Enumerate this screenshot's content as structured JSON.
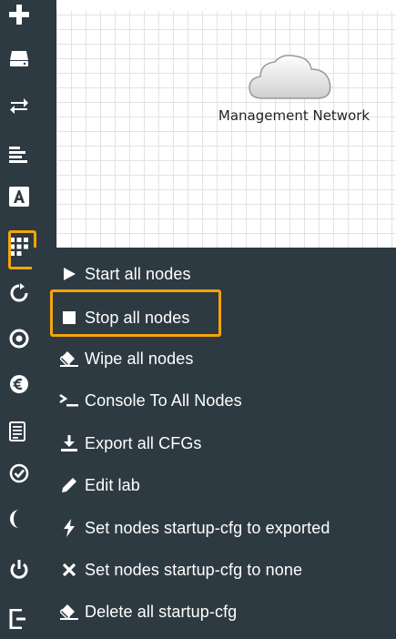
{
  "canvas": {
    "network_node": {
      "label": "Management Network",
      "icon": "cloud-icon"
    }
  },
  "toolbar": {
    "items": [
      {
        "name": "add-object",
        "icon": "plus-icon"
      },
      {
        "name": "nodes",
        "icon": "drive-icon"
      },
      {
        "name": "networks",
        "icon": "swap-arrows-icon"
      },
      {
        "name": "startup-configs",
        "icon": "text-align-icon"
      },
      {
        "name": "pictures",
        "icon": "font-icon"
      },
      {
        "name": "more-actions",
        "icon": "grid-icon",
        "highlighted": true
      },
      {
        "name": "refresh",
        "icon": "refresh-icon"
      },
      {
        "name": "status",
        "icon": "target-icon"
      },
      {
        "name": "lab-details",
        "icon": "euro-circle-icon"
      },
      {
        "name": "workbook",
        "icon": "list-doc-icon"
      },
      {
        "name": "check",
        "icon": "check-circle-icon"
      },
      {
        "name": "theme",
        "icon": "half-moon-icon"
      },
      {
        "name": "power",
        "icon": "power-icon"
      },
      {
        "name": "close-lab",
        "icon": "exit-icon"
      }
    ]
  },
  "menu": {
    "items": [
      {
        "label": "Start all nodes",
        "icon": "play-icon"
      },
      {
        "label": "Stop all nodes",
        "icon": "stop-icon",
        "highlighted": true
      },
      {
        "label": "Wipe all nodes",
        "icon": "eraser-icon"
      },
      {
        "label": "Console To All Nodes",
        "icon": "terminal-icon"
      },
      {
        "label": "Export all CFGs",
        "icon": "download-icon"
      },
      {
        "label": "Edit lab",
        "icon": "pencil-icon"
      },
      {
        "label": "Set nodes startup-cfg to exported",
        "icon": "bolt-icon"
      },
      {
        "label": "Set nodes startup-cfg to none",
        "icon": "x-icon"
      },
      {
        "label": "Delete all startup-cfg",
        "icon": "eraser-icon"
      }
    ]
  },
  "colors": {
    "sidebar_bg": "#2e3a41",
    "menu_bg": "#2e3a41",
    "highlight": "#f5a40c",
    "text": "#ffffff",
    "grid_line": "#e3e3e3"
  }
}
